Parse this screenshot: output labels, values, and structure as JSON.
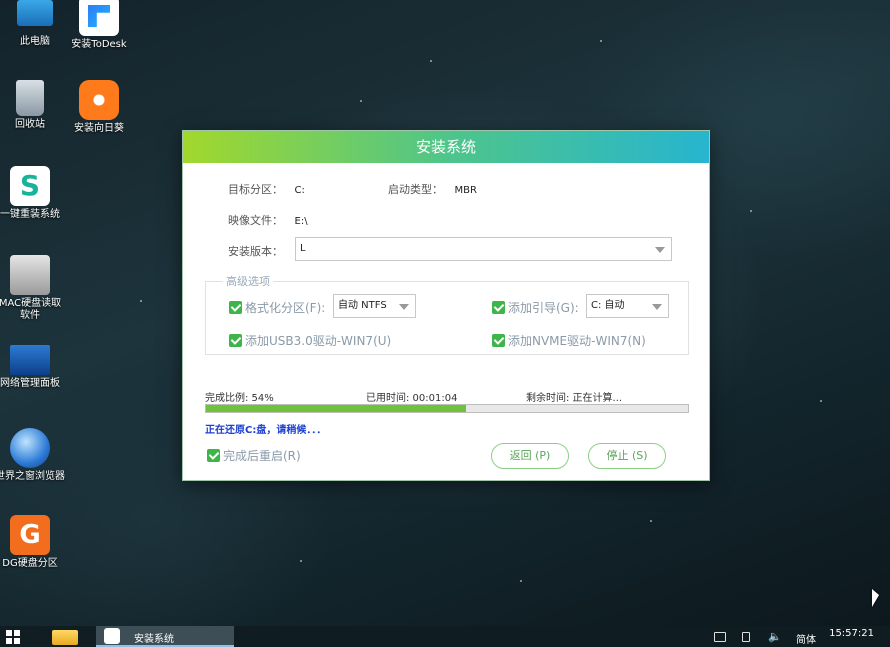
{
  "desktop": {
    "icons": [
      {
        "label": "此电脑",
        "icon": "computer-icon"
      },
      {
        "label": "安装ToDesk",
        "icon": "todesk-icon"
      },
      {
        "label": "回收站",
        "icon": "recycle-bin-icon"
      },
      {
        "label": "安装向日葵",
        "icon": "sunflower-icon"
      },
      {
        "label": "一键重装系统",
        "icon": "reinstall-system-icon"
      },
      {
        "label": "MAC硬盘读取软件",
        "icon": "mac-disk-icon"
      },
      {
        "label": "网络管理面板",
        "icon": "network-panel-icon"
      },
      {
        "label": "世界之窗浏览器",
        "icon": "browser-globe-icon"
      },
      {
        "label": "DG硬盘分区",
        "icon": "diskgenius-icon"
      }
    ]
  },
  "dialog": {
    "title": "安装系统",
    "target_partition_label": "目标分区：",
    "target_partition_value": "C:",
    "boot_type_label": "启动类型：",
    "boot_type_value": "MBR",
    "image_file_label": "映像文件：",
    "image_file_value": "E:\\",
    "install_version_label": "安装版本：",
    "install_version_value": "L",
    "advanced_title": "高级选项",
    "format_partition_label": "格式化分区(F):",
    "format_partition_value": "自动 NTFS",
    "add_boot_label": "添加引导(G):",
    "add_boot_value": "C: 自动",
    "usb3_label": "添加USB3.0驱动-WIN7(U)",
    "nvme_label": "添加NVME驱动-WIN7(N)",
    "progress_label": "完成比例: 54%",
    "progress_percent": 54,
    "elapsed_label": "已用时间: 00:01:04",
    "remaining_label": "剩余时间: 正在计算...",
    "status_text": "正在还原C:盘，请稍候．．．",
    "reboot_label": "完成后重启(R)",
    "back_button": "返回 (P)",
    "stop_button": "停止 (S)"
  },
  "taskbar": {
    "task_label": "安装系统",
    "lang": "简体",
    "time": "15:57:21"
  },
  "colors": {
    "title_gradient_start": "#a2d82c",
    "title_gradient_end": "#27b5cf",
    "progress": "#6fc33c",
    "status": "#1b3fd0",
    "checkbox": "#3eb54a"
  }
}
